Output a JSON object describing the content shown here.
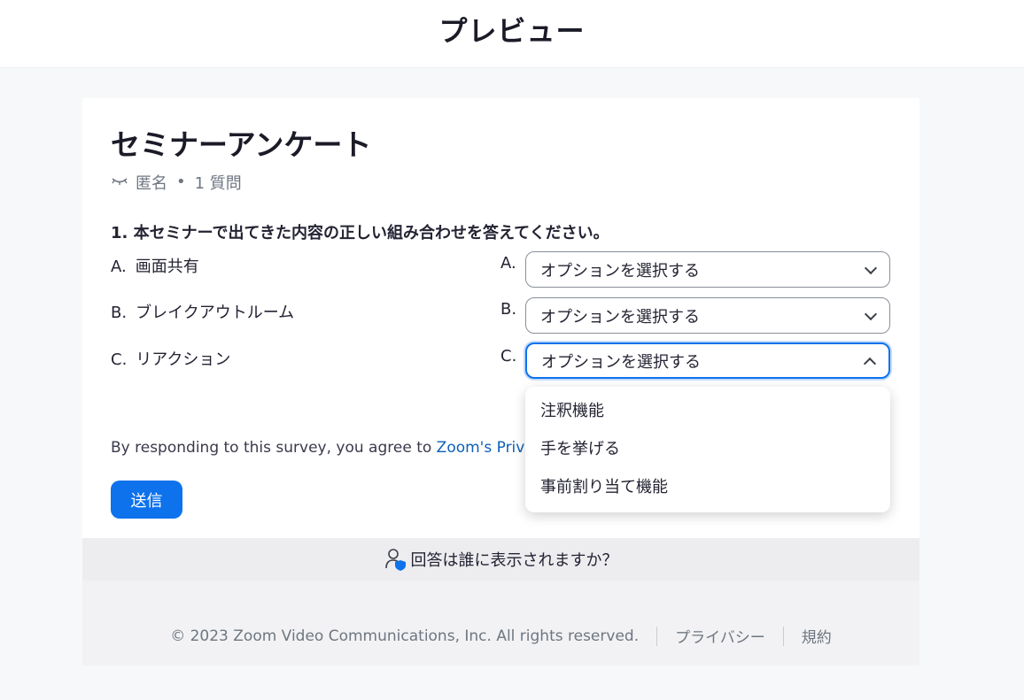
{
  "header": {
    "title": "プレビュー"
  },
  "survey": {
    "title": "セミナーアンケート",
    "anonymous_label": "匿名",
    "dot": "•",
    "question_count": "1 質問",
    "question": "1. 本セミナーで出てきた内容の正しい組み合わせを答えてください。",
    "rows": [
      {
        "letter": "A.",
        "text": "画面共有",
        "select_letter": "A.",
        "select_value": "オプションを選択する"
      },
      {
        "letter": "B.",
        "text": "ブレイクアウトルーム",
        "select_letter": "B.",
        "select_value": "オプションを選択する"
      },
      {
        "letter": "C.",
        "text": "リアクション",
        "select_letter": "C.",
        "select_value": "オプションを選択する"
      }
    ],
    "dropdown_options": [
      "注釈機能",
      "手を挙げる",
      "事前割り当て機能"
    ],
    "consent_text": "By responding to this survey, you agree to ",
    "consent_link": "Zoom's Privacy",
    "submit_label": "送信"
  },
  "who_sees": {
    "label": "回答は誰に表示されますか？"
  },
  "footer": {
    "copyright": "© 2023 Zoom Video Communications, Inc. All rights reserved.",
    "privacy": "プライバシー",
    "terms": "規約"
  },
  "colors": {
    "accent": "#0e72ed",
    "text": "#232333",
    "muted": "#6e7680"
  },
  "icons": {
    "anonymous": "closed-eye-icon",
    "chevron": "chevron-down-icon",
    "who": "user-shield-icon"
  }
}
